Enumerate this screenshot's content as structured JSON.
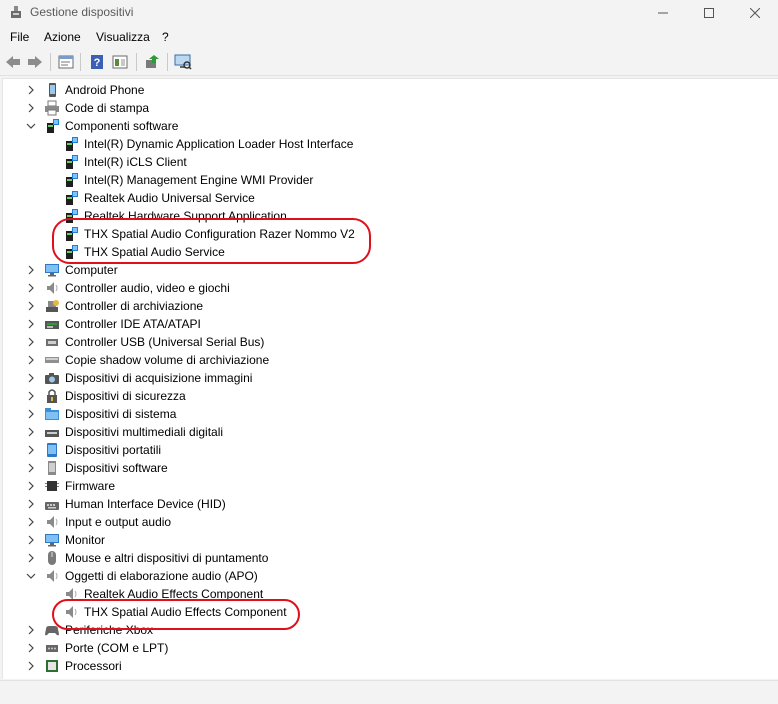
{
  "window": {
    "title": "Gestione dispositivi",
    "controls": [
      "minimize-icon",
      "maximize-icon",
      "close-icon"
    ]
  },
  "menu": [
    "File",
    "Azione",
    "Visualizza",
    "?"
  ],
  "toolbar": [
    "back-icon",
    "forward-icon",
    "properties-icon",
    "help-icon",
    "show-hidden-icon",
    "update-driver-icon",
    "scan-hardware-icon"
  ],
  "tree": [
    {
      "label": "Android Phone",
      "level": 0,
      "expander": "collapsed",
      "icon": "phone-icon"
    },
    {
      "label": "Code di stampa",
      "level": 0,
      "expander": "collapsed",
      "icon": "printer-icon"
    },
    {
      "label": "Componenti software",
      "level": 0,
      "expander": "expanded",
      "icon": "software-component-icon"
    },
    {
      "label": "Intel(R) Dynamic Application Loader Host Interface",
      "level": 1,
      "expander": "none",
      "icon": "software-component-icon"
    },
    {
      "label": "Intel(R) iCLS Client",
      "level": 1,
      "expander": "none",
      "icon": "software-component-icon"
    },
    {
      "label": "Intel(R) Management Engine WMI Provider",
      "level": 1,
      "expander": "none",
      "icon": "software-component-icon"
    },
    {
      "label": "Realtek Audio Universal Service",
      "level": 1,
      "expander": "none",
      "icon": "software-component-icon"
    },
    {
      "label": "Realtek Hardware Support Application",
      "level": 1,
      "expander": "none",
      "icon": "software-component-icon"
    },
    {
      "label": "THX Spatial Audio Configuration Razer Nommo V2",
      "level": 1,
      "expander": "none",
      "icon": "software-component-icon"
    },
    {
      "label": "THX Spatial Audio Service",
      "level": 1,
      "expander": "none",
      "icon": "software-component-icon"
    },
    {
      "label": "Computer",
      "level": 0,
      "expander": "collapsed",
      "icon": "monitor-icon"
    },
    {
      "label": "Controller audio, video e giochi",
      "level": 0,
      "expander": "collapsed",
      "icon": "speaker-icon"
    },
    {
      "label": "Controller di archiviazione",
      "level": 0,
      "expander": "collapsed",
      "icon": "storage-controller-icon"
    },
    {
      "label": "Controller IDE ATA/ATAPI",
      "level": 0,
      "expander": "collapsed",
      "icon": "ide-controller-icon"
    },
    {
      "label": "Controller USB (Universal Serial Bus)",
      "level": 0,
      "expander": "collapsed",
      "icon": "usb-icon"
    },
    {
      "label": "Copie shadow volume di archiviazione",
      "level": 0,
      "expander": "collapsed",
      "icon": "drive-icon"
    },
    {
      "label": "Dispositivi di acquisizione immagini",
      "level": 0,
      "expander": "collapsed",
      "icon": "camera-icon"
    },
    {
      "label": "Dispositivi di sicurezza",
      "level": 0,
      "expander": "collapsed",
      "icon": "security-icon"
    },
    {
      "label": "Dispositivi di sistema",
      "level": 0,
      "expander": "collapsed",
      "icon": "system-folder-icon"
    },
    {
      "label": "Dispositivi multimediali digitali",
      "level": 0,
      "expander": "collapsed",
      "icon": "media-device-icon"
    },
    {
      "label": "Dispositivi portatili",
      "level": 0,
      "expander": "collapsed",
      "icon": "portable-device-icon"
    },
    {
      "label": "Dispositivi software",
      "level": 0,
      "expander": "collapsed",
      "icon": "software-device-icon"
    },
    {
      "label": "Firmware",
      "level": 0,
      "expander": "collapsed",
      "icon": "chip-icon"
    },
    {
      "label": "Human Interface Device (HID)",
      "level": 0,
      "expander": "collapsed",
      "icon": "hid-icon"
    },
    {
      "label": "Input e output audio",
      "level": 0,
      "expander": "collapsed",
      "icon": "speaker-icon"
    },
    {
      "label": "Monitor",
      "level": 0,
      "expander": "collapsed",
      "icon": "monitor-icon"
    },
    {
      "label": "Mouse e altri dispositivi di puntamento",
      "level": 0,
      "expander": "collapsed",
      "icon": "mouse-icon"
    },
    {
      "label": "Oggetti di elaborazione audio (APO)",
      "level": 0,
      "expander": "expanded",
      "icon": "speaker-icon"
    },
    {
      "label": "Realtek Audio Effects Component",
      "level": 1,
      "expander": "none",
      "icon": "speaker-icon"
    },
    {
      "label": "THX Spatial Audio Effects Component",
      "level": 1,
      "expander": "none",
      "icon": "speaker-icon"
    },
    {
      "label": "Periferiche Xbox",
      "level": 0,
      "expander": "collapsed",
      "icon": "gamepad-icon"
    },
    {
      "label": "Porte (COM e LPT)",
      "level": 0,
      "expander": "collapsed",
      "icon": "port-icon"
    },
    {
      "label": "Processori",
      "level": 0,
      "expander": "collapsed",
      "icon": "processor-icon"
    }
  ],
  "annotation_color": "#e0101b"
}
